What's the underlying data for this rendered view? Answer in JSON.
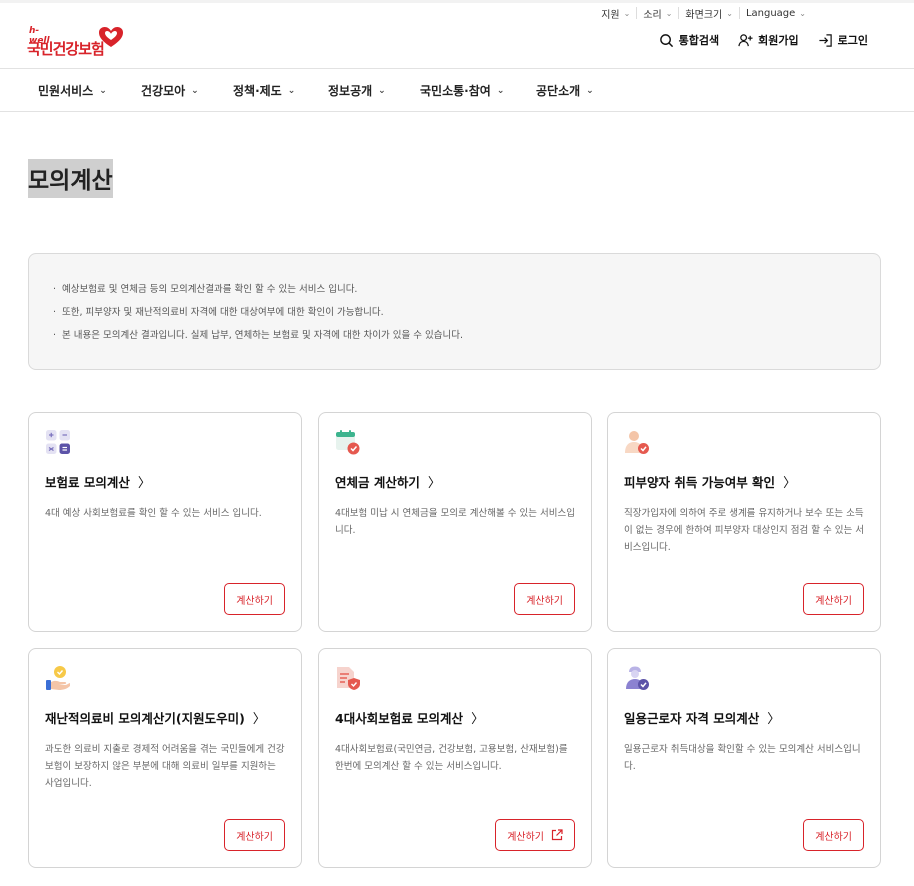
{
  "utility": [
    {
      "label": "지원"
    },
    {
      "label": "소리"
    },
    {
      "label": "화면크기"
    },
    {
      "label": "Language"
    }
  ],
  "logo": {
    "small": "h-well",
    "large": "국민건강보험"
  },
  "tools": {
    "search": "통합검색",
    "join": "회원가입",
    "login": "로그인"
  },
  "gnb": [
    "민원서비스",
    "건강모아",
    "정책·제도",
    "정보공개",
    "국민소통·참여",
    "공단소개"
  ],
  "page_title": "모의계산",
  "info": [
    "예상보험료 및 연체금 등의 모의계산결과를 확인 할 수 있는 서비스 입니다.",
    "또한, 피부양자 및 재난적의료비 자격에 대한 대상여부에 대한 확인이 가능합니다.",
    "본 내용은 모의계산 결과입니다. 실제 납부, 연체하는 보험료 및 자격에 대한 차이가 있을 수 있습니다."
  ],
  "cards": [
    {
      "title": "보험료 모의계산",
      "desc": "4대 예상 사회보험료를 확인 할 수 있는 서비스 입니다.",
      "button": "계산하기",
      "icon": "calculator-icon"
    },
    {
      "title": "연체금 계산하기",
      "desc": "4대보험 미납 시 연체금을 모의로 계산해볼 수 있는 서비스입니다.",
      "button": "계산하기",
      "icon": "calendar-icon"
    },
    {
      "title": "피부양자 취득 가능여부 확인",
      "desc": "직장가입자에 의하여 주로 생계를 유지하거나 보수 또는 소득이 없는 경우에 한하여 피부양자 대상인지 점검 할 수 있는 서비스입니다.",
      "button": "계산하기",
      "icon": "person-check-icon"
    },
    {
      "title": "재난적의료비 모의계산기(지원도우미)",
      "desc": "과도한 의료비 지출로 경제적 어려움을 겪는 국민들에게 건강보험이 보장하지 않은 부분에 대해 의료비 일부를 지원하는 사업입니다.",
      "button": "계산하기",
      "icon": "coin-hand-icon"
    },
    {
      "title": "4대사회보험료 모의계산",
      "desc": "4대사회보험료(국민연금, 건강보험, 고용보험, 산재보험)를 한번에 모의계산 할 수 있는 서비스입니다.",
      "button": "계산하기",
      "icon": "document-shield-icon"
    },
    {
      "title": "일용근로자 자격 모의계산",
      "desc": "일용근로자 취득대상을 확인할 수 있는 모의계산 서비스입니다.",
      "button": "계산하기",
      "icon": "worker-check-icon"
    }
  ],
  "colors": {
    "accent": "#d8232a"
  }
}
